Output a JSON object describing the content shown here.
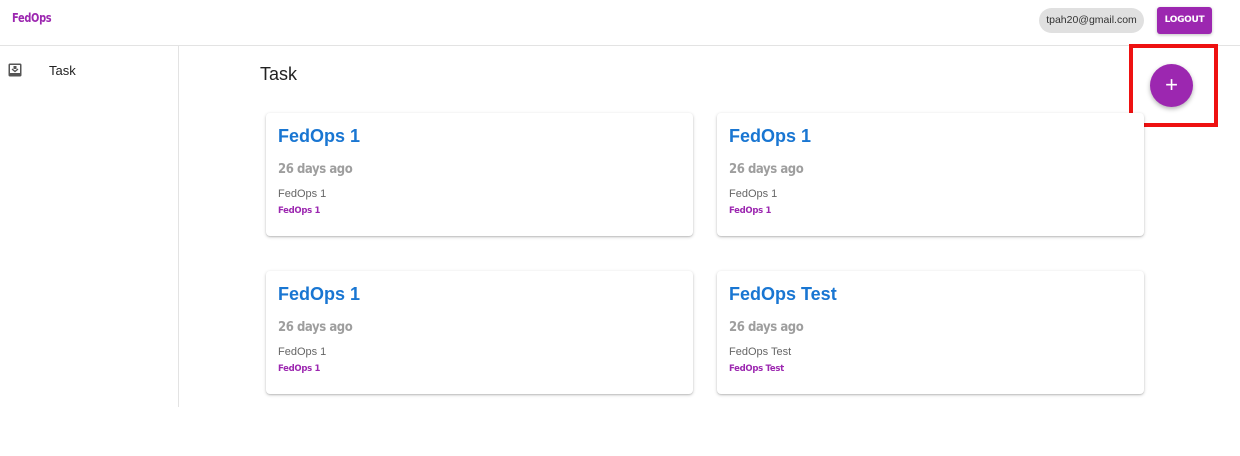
{
  "header": {
    "brand": "FedOps",
    "user_email": "tpah20@gmail.com",
    "logout_label": "LOGOUT"
  },
  "sidebar": {
    "items": [
      {
        "label": "Task",
        "icon": "inbox-icon"
      }
    ]
  },
  "main": {
    "title": "Task",
    "add_button": {
      "icon": "plus-icon",
      "label": "+"
    },
    "tasks": [
      {
        "title": "FedOps 1",
        "age": "26 days ago",
        "description": "FedOps 1",
        "tag": "FedOps 1"
      },
      {
        "title": "FedOps 1",
        "age": "26 days ago",
        "description": "FedOps 1",
        "tag": "FedOps 1"
      },
      {
        "title": "FedOps 1",
        "age": "26 days ago",
        "description": "FedOps 1",
        "tag": "FedOps 1"
      },
      {
        "title": "FedOps Test",
        "age": "26 days ago",
        "description": "FedOps Test",
        "tag": "FedOps Test"
      }
    ]
  },
  "colors": {
    "brand": "#9c27b0",
    "link": "#1976d2",
    "highlight": "#ee1111",
    "muted": "#9e9e9e"
  }
}
